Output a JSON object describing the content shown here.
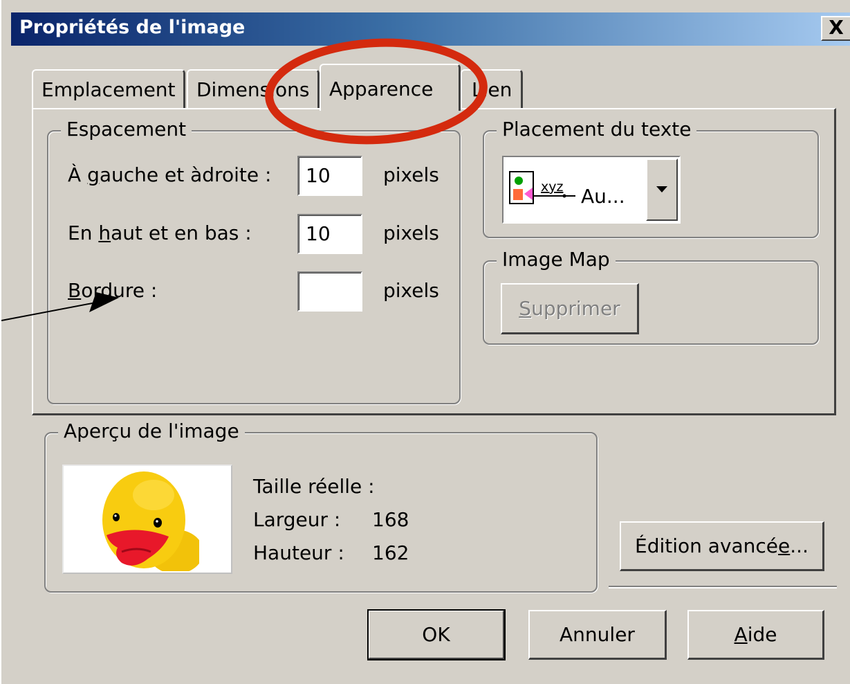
{
  "dialog": {
    "title": "Propriétés de l'image",
    "close_label": "X"
  },
  "tabs": [
    {
      "label": "Emplacement",
      "active": false
    },
    {
      "label": "Dimensions",
      "active": false
    },
    {
      "label": "Apparence",
      "active": true
    },
    {
      "label": "Lien",
      "active": false
    }
  ],
  "spacing": {
    "legend": "Espacement",
    "left_right": {
      "label_pre": "À ",
      "label_key": "g",
      "label_post": "auche et àdroite :",
      "value": "10",
      "unit": "pixels"
    },
    "top_bottom": {
      "label_pre": "En ",
      "label_key": "h",
      "label_post": "aut et en bas :",
      "value": "10",
      "unit": "pixels"
    },
    "border": {
      "label_pre": "",
      "label_key": "B",
      "label_post": "ordure :",
      "value": "",
      "unit": "pixels"
    }
  },
  "text_placement": {
    "legend": "Placement du texte",
    "icon_text": "xyz",
    "selected": "Au..."
  },
  "image_map": {
    "legend": "Image Map",
    "delete_key": "S",
    "delete_rest": "upprimer"
  },
  "preview": {
    "legend": "Aperçu de l'image",
    "actual_size_label": "Taille réelle :",
    "width_label": "Largeur :",
    "width_value": "168",
    "height_label": "Hauteur :",
    "height_value": "162"
  },
  "advanced_edit": {
    "label_pre": "Édition avancé",
    "label_key": "e",
    "label_post": "..."
  },
  "buttons": {
    "ok": "OK",
    "cancel": "Annuler",
    "help_key": "A",
    "help_rest": "ide"
  },
  "colors": {
    "annotation_circle": "#d42a0e",
    "face": "#d4d0c8",
    "title_start": "#0a246a",
    "title_end": "#a6caf0"
  }
}
